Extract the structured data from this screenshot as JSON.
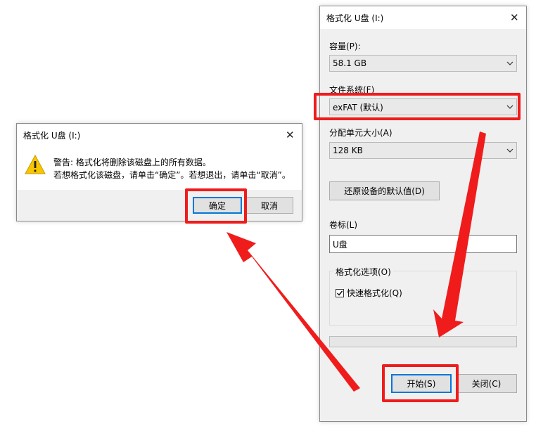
{
  "format_window": {
    "title": "格式化 U盘 (I:)",
    "close_glyph": "✕",
    "capacity": {
      "label": "容量(P):",
      "value": "58.1 GB"
    },
    "filesystem": {
      "label": "文件系统(F)",
      "value": "exFAT (默认)"
    },
    "allocation": {
      "label": "分配单元大小(A)",
      "value": "128 KB"
    },
    "restore_defaults_label": "还原设备的默认值(D)",
    "volume": {
      "label": "卷标(L)",
      "value": "U盘"
    },
    "format_options": {
      "label": "格式化选项(O)",
      "quick_format": {
        "label": "快速格式化(Q)",
        "checked": true
      }
    },
    "progress": 0,
    "start_label": "开始(S)",
    "close_label": "关闭(C)"
  },
  "confirm_dialog": {
    "title": "格式化 U盘 (I:)",
    "close_glyph": "✕",
    "icon": "warning-icon",
    "message_line1": "警告: 格式化将删除该磁盘上的所有数据。",
    "message_line2": "若想格式化该磁盘，请单击“确定”。若想退出，请单击“取消”。",
    "ok_label": "确定",
    "cancel_label": "取消"
  },
  "colors": {
    "annotation_red": "#f01c1c",
    "warning_yellow": "#f7c600",
    "focus_blue": "#0078d7"
  }
}
